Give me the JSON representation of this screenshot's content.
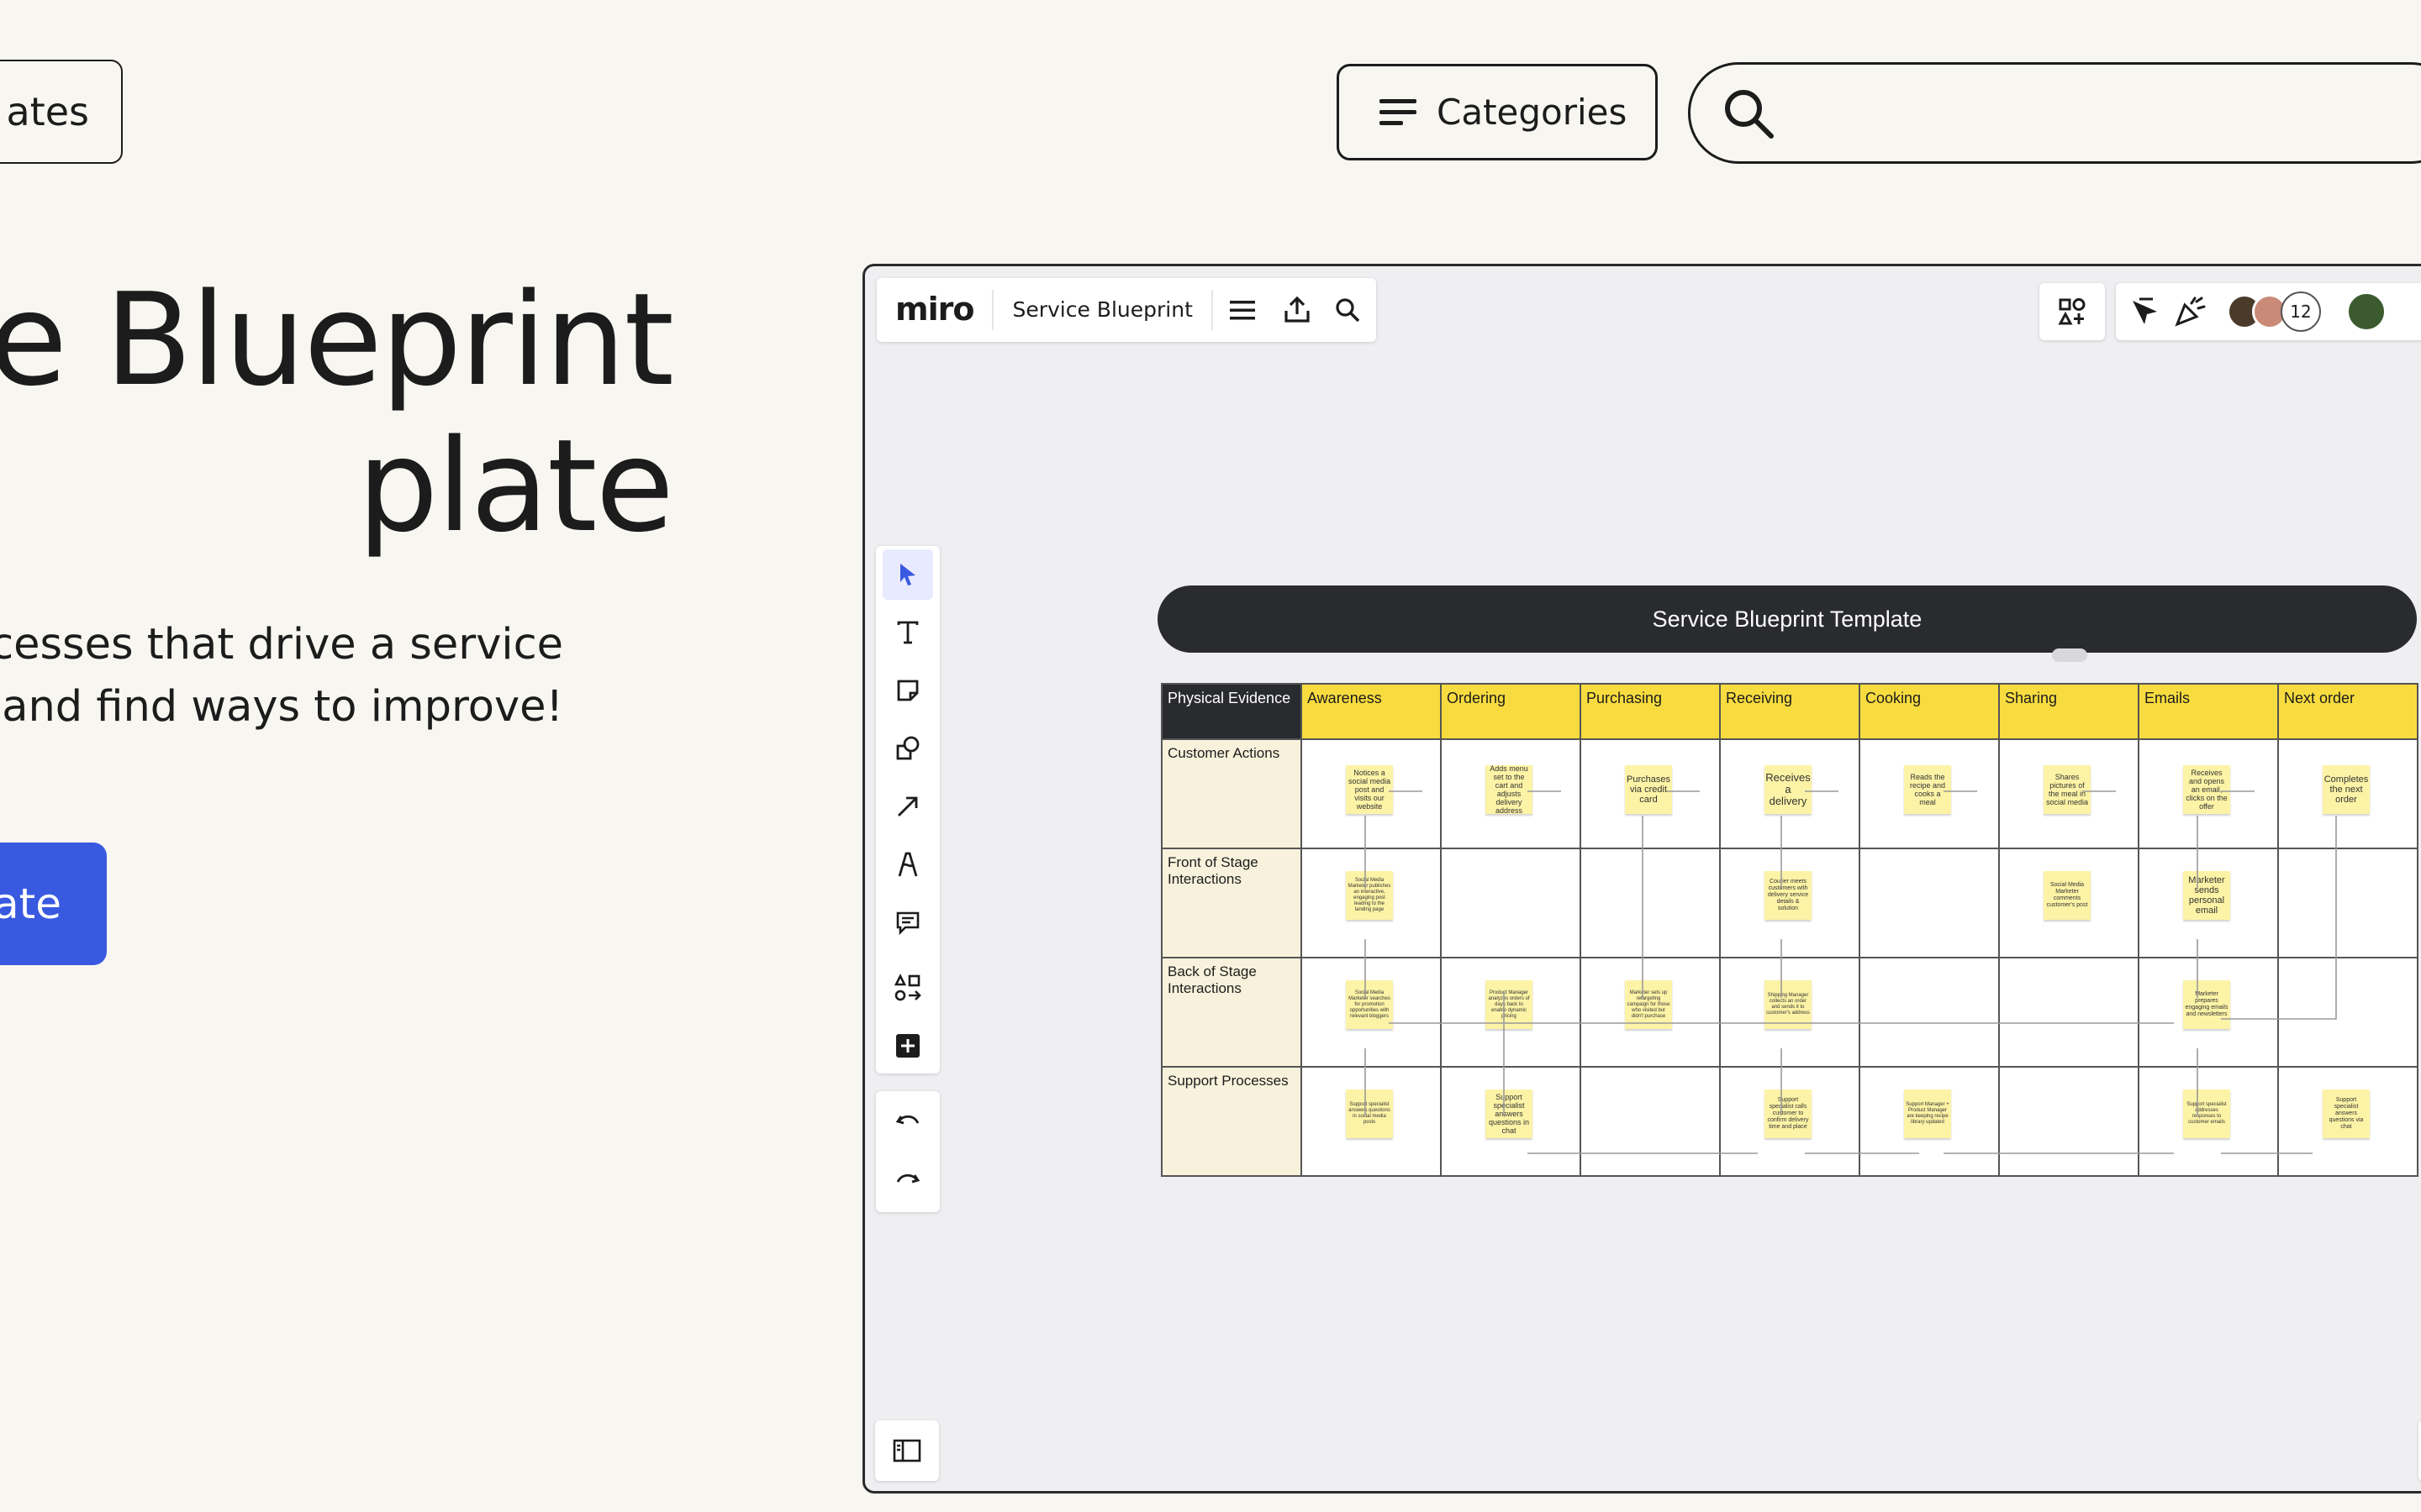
{
  "header": {
    "templates_label": "ates",
    "categories_label": "Categories",
    "search_placeholder": ""
  },
  "hero": {
    "title_line1": "ce Blueprint",
    "title_line2": "plate",
    "subtitle_line1": "cesses that drive a service",
    "subtitle_line2": "- and find ways to improve!",
    "cta_label": "ate"
  },
  "board": {
    "logo": "miro",
    "name": "Service Blueprint",
    "collaborator_count": "12",
    "blueprint_title": "Service Blueprint Template",
    "corner_header": "Physical Evidence",
    "stages": [
      "Awareness",
      "Ordering",
      "Purchasing",
      "Receiving",
      "Cooking",
      "Sharing",
      "Emails",
      "Next order"
    ],
    "rows": [
      "Customer Actions",
      "Front of Stage Interactions",
      "Back of Stage Interactions",
      "Support Processes"
    ],
    "notes": {
      "customer": [
        "Notices a social media post and visits our website",
        "Adds menu set to the cart and adjusts delivery address",
        "Purchases via credit card",
        "Receives a delivery",
        "Reads the recipe and cooks a meal",
        "Shares pictures of the meal in social media",
        "Receives and opens an email, clicks on the offer",
        "Completes the next order"
      ],
      "front": [
        "Social Media Marketer publishes an interactive, engaging post leading to the landing page",
        "Courier meets customers with delivery service details & solution",
        "Social Media Marketer comments customer's post",
        "Marketer sends personal email"
      ],
      "back": [
        "Social Media Marketer searches for promotion opportunities with relevant bloggers",
        "Product Manager analyzes orders of days back to enable dynamic pricing",
        "Marketer sets up retargeting campaign for those who visited but didn't purchase",
        "Shipping Manager collects an order and sends it to customer's address",
        "Marketer prepares engaging emails and newsletters"
      ],
      "support": [
        "Support specialist answers questions in social media posts",
        "Support specialist answers questions in chat",
        "Support specialist calls customer to confirm delivery time and place",
        "Support Manager + Product Manager are keeping recipe library updated",
        "Support specialist addresses responses to customer emails",
        "Support specialist answers questions via chat"
      ]
    }
  }
}
